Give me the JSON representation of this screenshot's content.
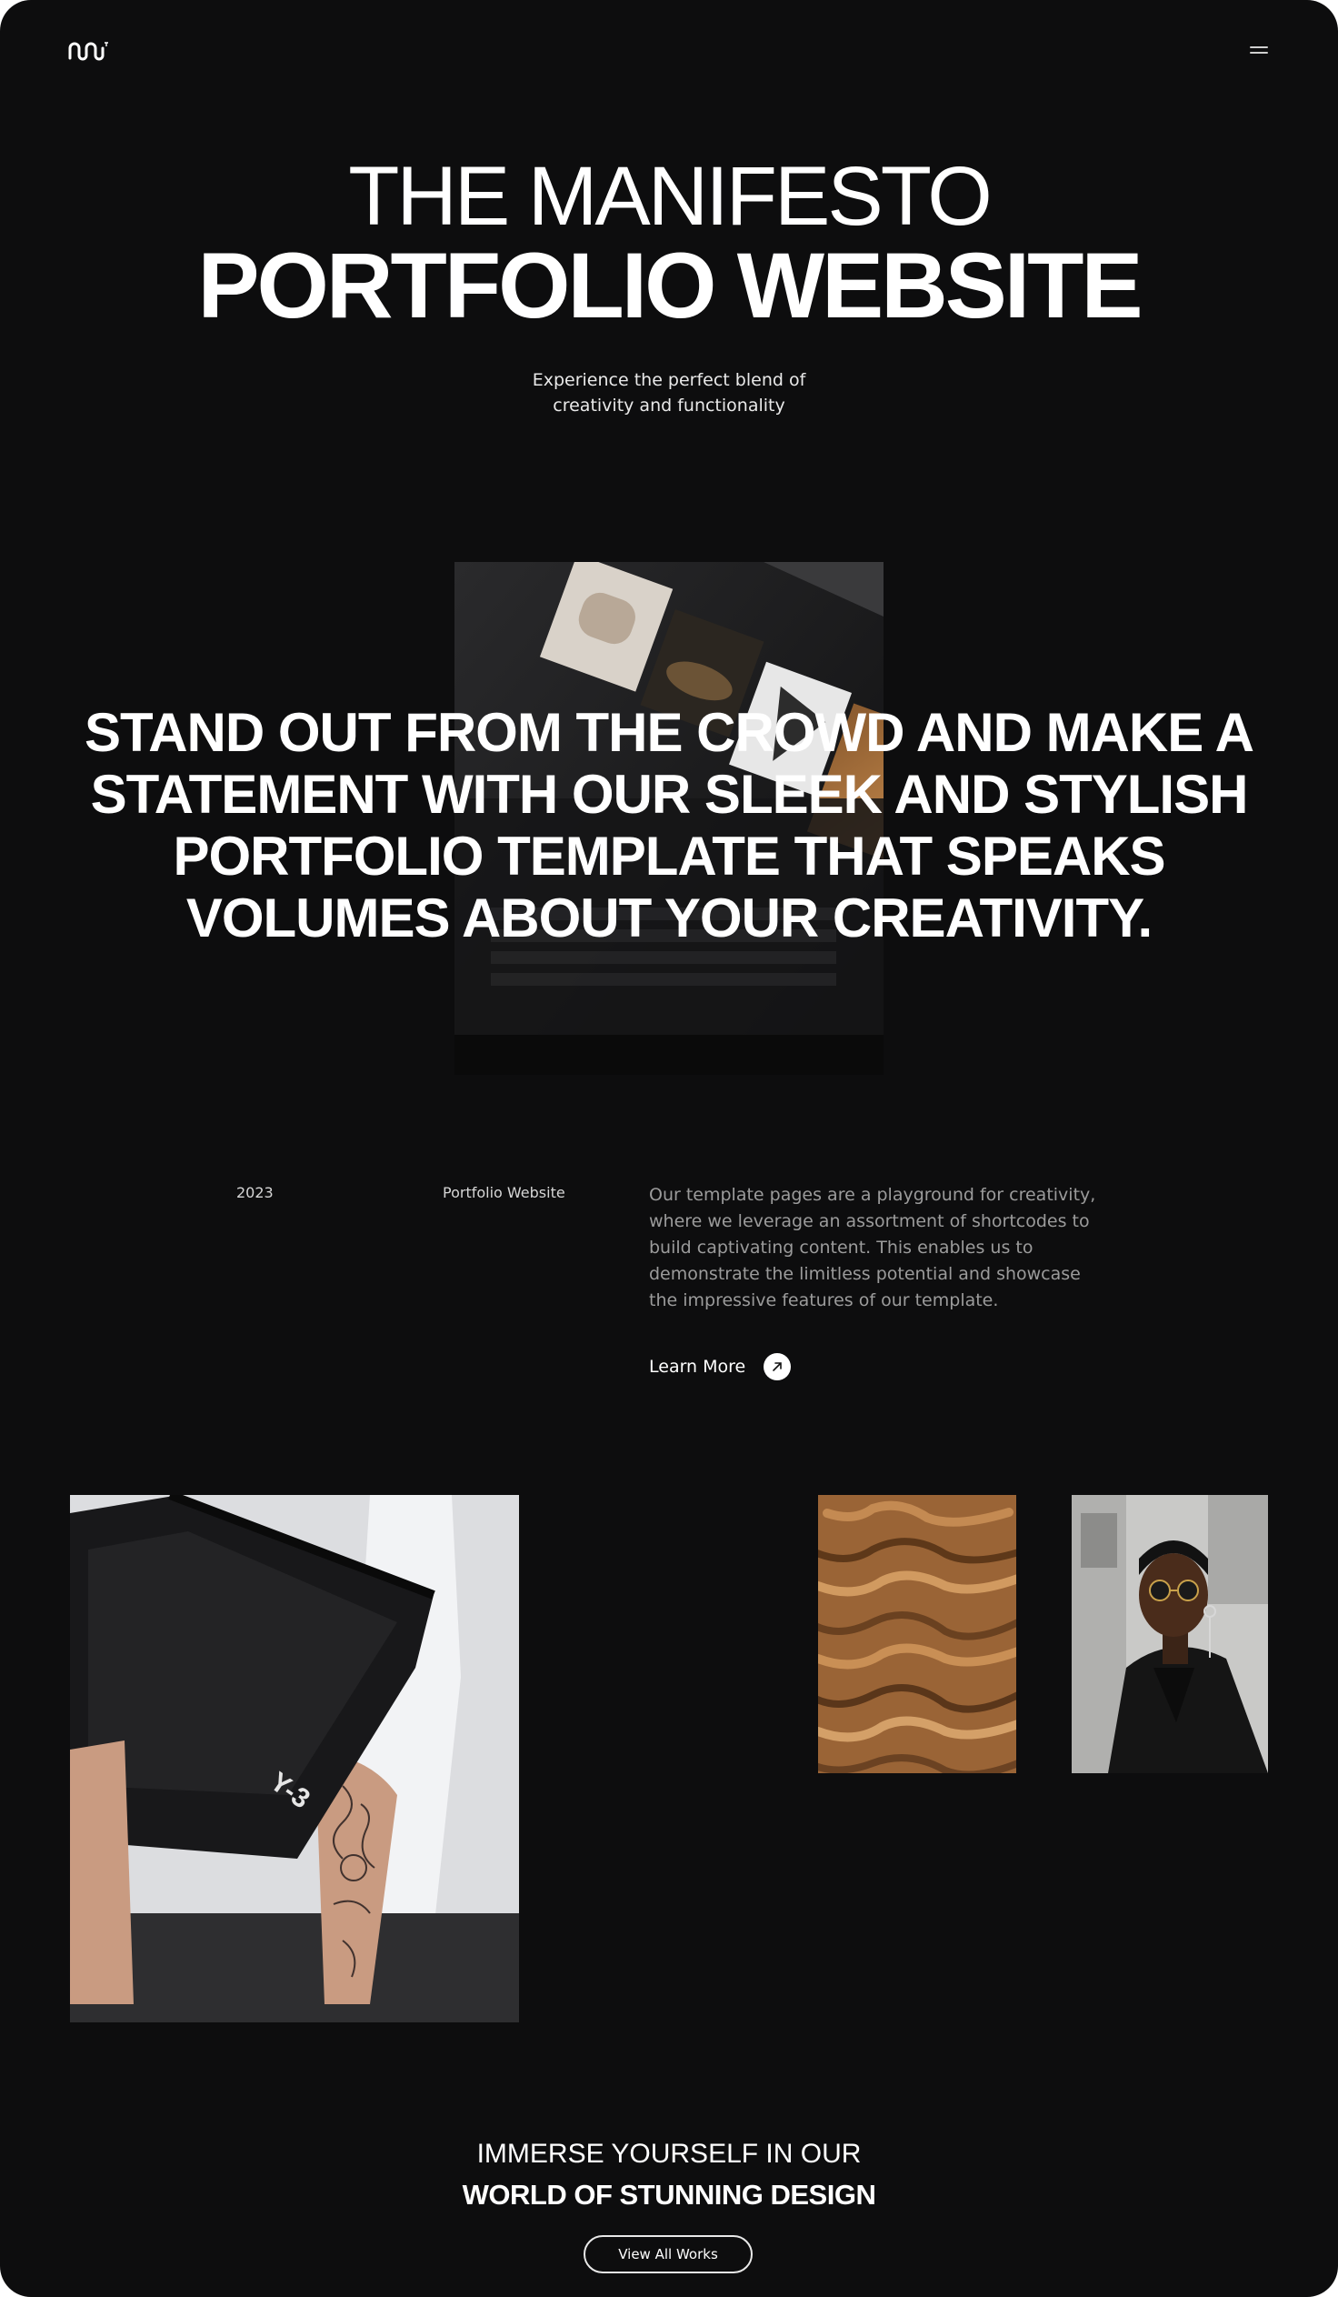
{
  "header": {
    "logo_icon": "brand-logo-icon",
    "menu_icon": "hamburger-menu-icon"
  },
  "hero": {
    "title_line1": "THE MANIFESTO",
    "title_line2": "PORTFOLIO WEBSITE",
    "subtitle": "Experience the perfect blend of creativity and functionality"
  },
  "statement": {
    "text": "STAND OUT FROM THE CROWD AND MAKE A STATEMENT WITH OUR SLEEK AND STYLISH PORTFOLIO TEMPLATE THAT SPEAKS VOLUMES ABOUT YOUR CREATIVITY."
  },
  "project": {
    "year": "2023",
    "type": "Portfolio Website",
    "description": "Our template pages are a playground for creativity, where we leverage an assortment of shortcodes to build captivating content. This enables us to demonstrate the limitless potential and showcase the impressive features of our template.",
    "learn_more_label": "Learn More",
    "learn_more_icon": "arrow-up-right-icon"
  },
  "gallery": {
    "bag_brand_mark": "Y-3"
  },
  "cta": {
    "line1": "IMMERSE YOURSELF IN OUR",
    "line2": "WORLD OF STUNNING DESIGN",
    "button_label": "View All Works"
  },
  "colors": {
    "background": "#0d0d0e",
    "text": "#ffffff",
    "muted_text": "#9b9b9b"
  }
}
